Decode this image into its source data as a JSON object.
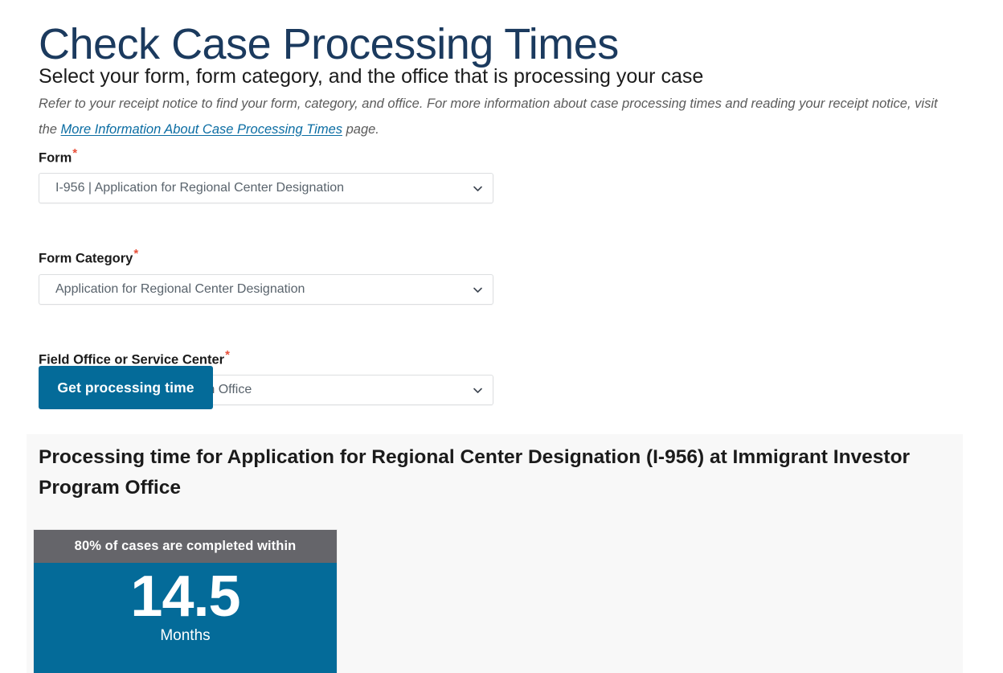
{
  "header": {
    "title": "Check Case Processing Times",
    "subtitle": "Select your form, form category, and the office that is processing your case",
    "intro_before": "Refer to your receipt notice to find your form, category, and office. For more information about case processing times and reading your receipt notice, visit the ",
    "intro_link": "More Information About Case Processing Times",
    "intro_after": " page."
  },
  "form": {
    "required_marker": "*",
    "fields": [
      {
        "label": "Form",
        "value": "I-956 | Application for Regional Center Designation",
        "icon": "chevron-down-icon"
      },
      {
        "label": "Form Category",
        "value": "Application for Regional Center Designation",
        "icon": "chevron-down-icon"
      },
      {
        "label": "Field Office or Service Center",
        "value": "Immigrant Investor Program Office",
        "icon": "chevron-down-icon"
      }
    ],
    "submit_label": "Get processing time"
  },
  "result": {
    "heading": "Processing time for Application for Regional Center Designation (I-956) at Immigrant Investor Program Office",
    "card": {
      "banner": "80% of cases are completed within",
      "value": "14.5",
      "unit": "Months"
    }
  },
  "colors": {
    "title_navy": "#1b3a5e",
    "brand_blue": "#046b99",
    "banner_gray": "#65656a",
    "link_blue": "#0b6da3",
    "required_red": "#e8503a",
    "panel_bg": "#f8f8f8"
  }
}
